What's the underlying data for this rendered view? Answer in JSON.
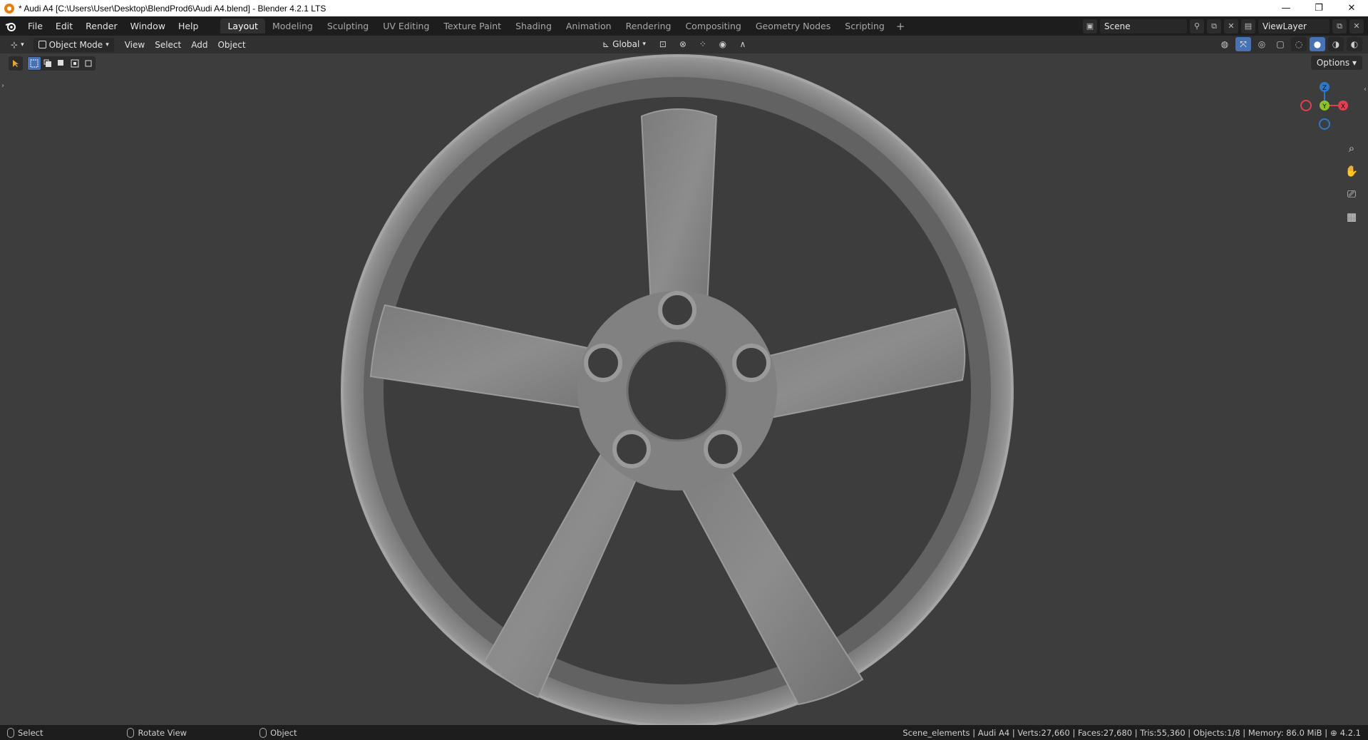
{
  "window": {
    "title": "* Audi A4 [C:\\Users\\User\\Desktop\\BlendProd6\\Audi A4.blend] - Blender 4.2.1 LTS",
    "minimize": "—",
    "restore": "❐",
    "close": "✕"
  },
  "menu": [
    "File",
    "Edit",
    "Render",
    "Window",
    "Help"
  ],
  "workspaces": {
    "active": "Layout",
    "tabs": [
      "Layout",
      "Modeling",
      "Sculpting",
      "UV Editing",
      "Texture Paint",
      "Shading",
      "Animation",
      "Rendering",
      "Compositing",
      "Geometry Nodes",
      "Scripting"
    ],
    "add": "+"
  },
  "scene": {
    "name": "Scene",
    "view_layer": "ViewLayer"
  },
  "header": {
    "mode": "Object Mode",
    "menus": [
      "View",
      "Select",
      "Add",
      "Object"
    ],
    "transform_orientation": "Global"
  },
  "viewport": {
    "options": "Options",
    "gizmo": {
      "z": "Z",
      "y": "Y",
      "x": "X"
    },
    "colors": {
      "x": "#e0404f",
      "y": "#8cc22a",
      "z": "#2e78c8",
      "wheel": "#8a8a8a",
      "background": "#3d3d3d"
    }
  },
  "status": {
    "hints": [
      "Select",
      "Rotate View",
      "Object"
    ],
    "stats": "Scene_elements | Audi A4 | Verts:27,660 | Faces:27,680 | Tris:55,360 | Objects:1/8 | Memory: 86.0 MiB | ",
    "version": "4.2.1"
  }
}
